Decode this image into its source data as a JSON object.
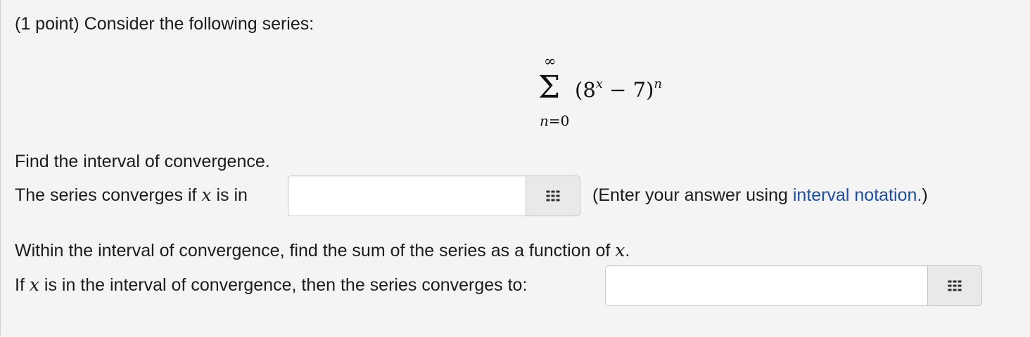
{
  "problem": {
    "header": "(1 point) Consider the following series:"
  },
  "series": {
    "upper": "∞",
    "sigma": "Σ",
    "lower_var": "n",
    "lower_eq": "=0",
    "term_base_open": "(8",
    "term_base_exp": "x",
    "term_rest": " − 7)",
    "term_outer_exp": "n"
  },
  "part1": {
    "prompt": "Find the interval of convergence.",
    "label_before": "The series converges if ",
    "label_var": "x",
    "label_after": " is in",
    "answer_value": "",
    "hint_before": "(Enter your answer using ",
    "hint_link": "interval notation.",
    "hint_after": ")",
    "palette_icon": "grid-icon"
  },
  "part2": {
    "prompt_before": "Within the interval of convergence, find the sum of the series as a function of ",
    "prompt_var": "x",
    "prompt_after": ".",
    "label_before": "If ",
    "label_var": "x",
    "label_after": " is in the interval of convergence, then the series converges to:",
    "answer_value": "",
    "palette_icon": "grid-icon"
  }
}
